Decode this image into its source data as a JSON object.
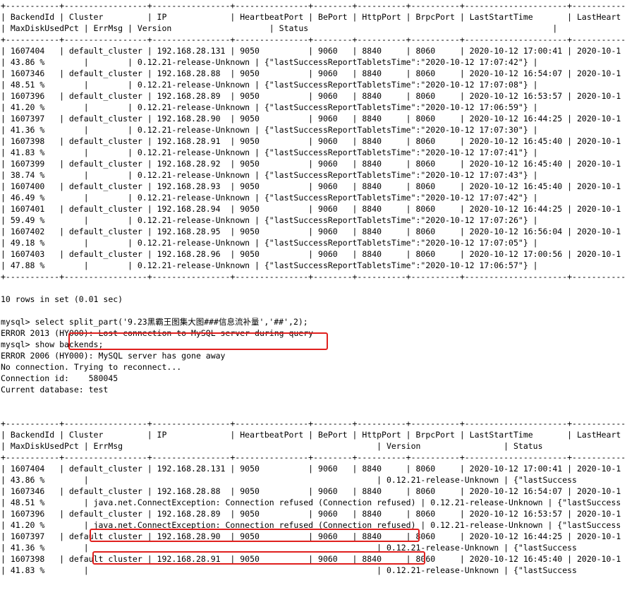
{
  "terminal": {
    "lines": [
      "+-----------+-----------------+----------------+---------------+--------+----------+----------+---------------------+----------------",
      "| BackendId | Cluster         | IP             | HeartbeatPort | BePort | HttpPort | BrpcPort | LastStartTime       | LastHeart",
      "| MaxDiskUsedPct | ErrMsg | Version                    | Status                                                  |",
      "+-----------+-----------------+----------------+---------------+--------+----------+----------+---------------------+----------------",
      "| 1607404   | default_cluster | 192.168.28.131 | 9050          | 9060   | 8840     | 8060     | 2020-10-12 17:00:41 | 2020-10-1",
      "| 43.86 %        |        | 0.12.21-release-Unknown | {\"lastSuccessReportTabletsTime\":\"2020-10-12 17:07:42\"} |",
      "| 1607346   | default_cluster | 192.168.28.88  | 9050          | 9060   | 8840     | 8060     | 2020-10-12 16:54:07 | 2020-10-1",
      "| 48.51 %        |        | 0.12.21-release-Unknown | {\"lastSuccessReportTabletsTime\":\"2020-10-12 17:07:08\"} |",
      "| 1607396   | default_cluster | 192.168.28.89  | 9050          | 9060   | 8840     | 8060     | 2020-10-12 16:53:57 | 2020-10-1",
      "| 41.20 %        |        | 0.12.21-release-Unknown | {\"lastSuccessReportTabletsTime\":\"2020-10-12 17:06:59\"} |",
      "| 1607397   | default_cluster | 192.168.28.90  | 9050          | 9060   | 8840     | 8060     | 2020-10-12 16:44:25 | 2020-10-1",
      "| 41.36 %        |        | 0.12.21-release-Unknown | {\"lastSuccessReportTabletsTime\":\"2020-10-12 17:07:30\"} |",
      "| 1607398   | default_cluster | 192.168.28.91  | 9050          | 9060   | 8840     | 8060     | 2020-10-12 16:45:40 | 2020-10-1",
      "| 41.83 %        |        | 0.12.21-release-Unknown | {\"lastSuccessReportTabletsTime\":\"2020-10-12 17:07:41\"} |",
      "| 1607399   | default_cluster | 192.168.28.92  | 9050          | 9060   | 8840     | 8060     | 2020-10-12 16:45:40 | 2020-10-1",
      "| 38.74 %        |        | 0.12.21-release-Unknown | {\"lastSuccessReportTabletsTime\":\"2020-10-12 17:07:43\"} |",
      "| 1607400   | default_cluster | 192.168.28.93  | 9050          | 9060   | 8840     | 8060     | 2020-10-12 16:45:40 | 2020-10-1",
      "| 46.49 %        |        | 0.12.21-release-Unknown | {\"lastSuccessReportTabletsTime\":\"2020-10-12 17:07:42\"} |",
      "| 1607401   | default_cluster | 192.168.28.94  | 9050          | 9060   | 8840     | 8060     | 2020-10-12 16:44:25 | 2020-10-1",
      "| 59.49 %        |        | 0.12.21-release-Unknown | {\"lastSuccessReportTabletsTime\":\"2020-10-12 17:07:26\"} |",
      "| 1607402   | default_cluster | 192.168.28.95  | 9050          | 9060   | 8840     | 8060     | 2020-10-12 16:56:04 | 2020-10-1",
      "| 49.18 %        |        | 0.12.21-release-Unknown | {\"lastSuccessReportTabletsTime\":\"2020-10-12 17:07:05\"} |",
      "| 1607403   | default_cluster | 192.168.28.96  | 9050          | 9060   | 8840     | 8060     | 2020-10-12 17:00:56 | 2020-10-1",
      "| 47.88 %        |        | 0.12.21-release-Unknown | {\"lastSuccessReportTabletsTime\":\"2020-10-12 17:06:57\"} |",
      "+-----------+-----------------+----------------+---------------+--------+----------+----------+---------------------+----------------",
      "",
      "10 rows in set (0.01 sec)",
      "",
      "mysql> select split_part('9.23黑霸王图集大图###信息流补量','##',2);",
      "ERROR 2013 (HY000): Lost connection to MySQL server during query",
      "mysql> show backends;",
      "ERROR 2006 (HY000): MySQL server has gone away",
      "No connection. Trying to reconnect...",
      "Connection id:    580045",
      "Current database: test",
      "",
      "",
      "+-----------+-----------------+----------------+---------------+--------+----------+----------+---------------------+----------------",
      "| BackendId | Cluster         | IP             | HeartbeatPort | BePort | HttpPort | BrpcPort | LastStartTime       | LastHeart",
      "| MaxDiskUsedPct | ErrMsg                                                    | Version                 | Status",
      "+-----------+-----------------+----------------+---------------+--------+----------+----------+---------------------+----------------",
      "| 1607404   | default_cluster | 192.168.28.131 | 9050          | 9060   | 8840     | 8060     | 2020-10-12 17:00:41 | 2020-10-1",
      "| 43.86 %        |                                                           | 0.12.21-release-Unknown | {\"lastSuccess",
      "| 1607346   | default_cluster | 192.168.28.88  | 9050          | 9060   | 8840     | 8060     | 2020-10-12 16:54:07 | 2020-10-1",
      "| 48.51 %        | java.net.ConnectException: Connection refused (Connection refused) | 0.12.21-release-Unknown | {\"lastSuccess",
      "| 1607396   | default_cluster | 192.168.28.89  | 9050          | 9060   | 8840     | 8060     | 2020-10-12 16:53:57 | 2020-10-1",
      "| 41.20 %        | java.net.ConnectException: Connection refused (Connection refused) | 0.12.21-release-Unknown | {\"lastSuccess",
      "| 1607397   | default_cluster | 192.168.28.90  | 9050          | 9060   | 8840     | 8060     | 2020-10-12 16:44:25 | 2020-10-1",
      "| 41.36 %        |                                                           | 0.12.21-release-Unknown | {\"lastSuccess",
      "| 1607398   | default_cluster | 192.168.28.91  | 9050          | 9060   | 8840     | 8060     | 2020-10-12 16:45:40 | 2020-10-1",
      "| 41.83 %        |                                                           | 0.12.21-release-Unknown | {\"lastSuccess"
    ]
  }
}
